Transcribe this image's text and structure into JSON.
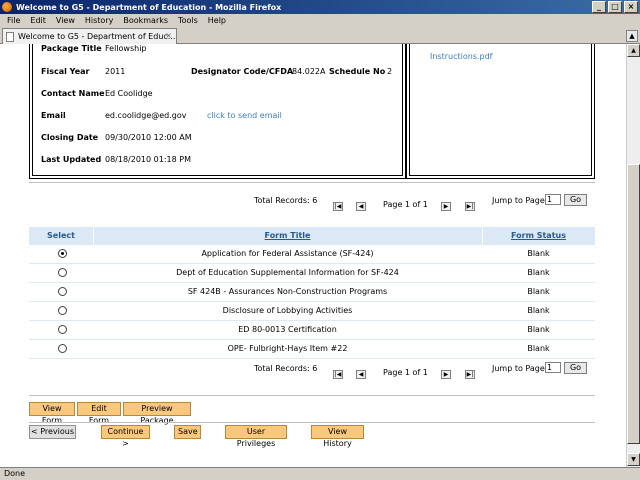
{
  "window": {
    "title": "Welcome to G5 - Department of Education - Mozilla Firefox",
    "min": "_",
    "max": "□",
    "close": "×"
  },
  "menu": [
    "File",
    "Edit",
    "View",
    "History",
    "Bookmarks",
    "Tools",
    "Help"
  ],
  "tab": {
    "label": "Welcome to G5 - Department of Educ...",
    "close": "×",
    "scroll": "▲"
  },
  "package": {
    "title_label": "Package Title",
    "title_value": "Fellowship",
    "fy_label": "Fiscal Year",
    "fy_value": "2011",
    "cfda_label": "Designator Code/CFDA",
    "cfda_value": "84.022A",
    "sched_label": "Schedule No",
    "sched_value": "2",
    "contact_label": "Contact Name",
    "contact_value": "Ed Coolidge",
    "email_label": "Email",
    "email_value": "ed.coolidge@ed.gov",
    "email_link": "click to send email",
    "closing_label": "Closing Date",
    "closing_value": "09/30/2010 12:00 AM",
    "updated_label": "Last Updated",
    "updated_value": "08/18/2010 01:18 PM",
    "instructions": "Instructions.pdf"
  },
  "pager": {
    "total": "Total Records: 6",
    "page": "Page 1 of 1",
    "jump": "Jump to Page",
    "jump_value": "1",
    "go": "Go",
    "first": "|◀",
    "prev": "◀",
    "next": "▶",
    "last": "▶|"
  },
  "grid": {
    "headers": {
      "select": "Select",
      "title": "Form Title",
      "status": "Form Status"
    },
    "rows": [
      {
        "title": "Application for Federal Assistance (SF-424)",
        "status": "Blank",
        "selected": true
      },
      {
        "title": "Dept of Education Supplemental Information for SF-424",
        "status": "Blank",
        "selected": false
      },
      {
        "title": "SF 424B - Assurances Non-Construction Programs",
        "status": "Blank",
        "selected": false
      },
      {
        "title": "Disclosure of Lobbying Activities",
        "status": "Blank",
        "selected": false
      },
      {
        "title": "ED 80-0013 Certification",
        "status": "Blank",
        "selected": false
      },
      {
        "title": "OPE- Fulbright-Hays Item #22",
        "status": "Blank",
        "selected": false
      }
    ]
  },
  "actions": {
    "view_form": "View Form",
    "edit_form": "Edit Form",
    "preview": "Preview Package"
  },
  "nav": {
    "previous": "< Previous",
    "continue": "Continue >",
    "save": "Save",
    "privileges": "User Privileges",
    "history": "View History"
  },
  "status": "Done",
  "scroll": {
    "up": "▲",
    "down": "▼"
  }
}
